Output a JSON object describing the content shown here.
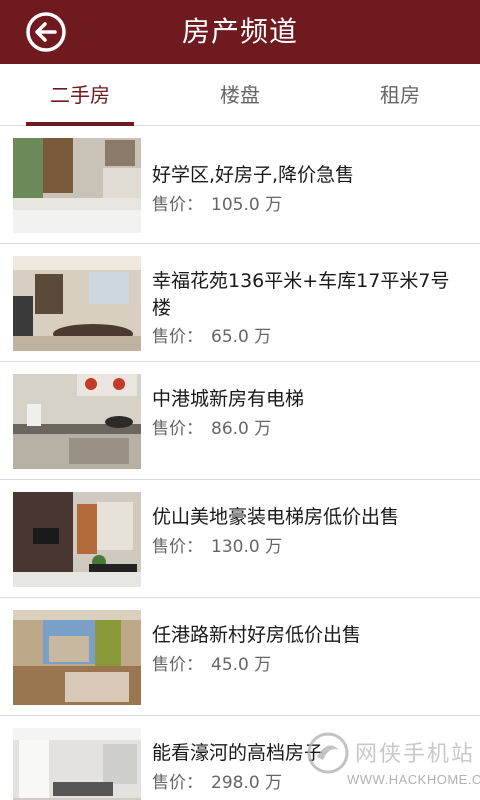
{
  "header": {
    "title": "房产频道",
    "back_icon": "back-arrow-icon",
    "background": "#6e1a1e"
  },
  "tabs": [
    {
      "label": "二手房",
      "active": true
    },
    {
      "label": "楼盘",
      "active": false
    },
    {
      "label": "租房",
      "active": false
    }
  ],
  "listings": [
    {
      "title": "好学区,好房子,降价急售",
      "price_label": "售价：",
      "price": "105.0 万",
      "image": "bedroom-photo"
    },
    {
      "title": "幸福花苑136平米+车库17平米7号楼",
      "price_label": "售价：",
      "price": "65.0 万",
      "image": "living-room-photo"
    },
    {
      "title": "中港城新房有电梯",
      "price_label": "售价：",
      "price": "86.0 万",
      "image": "kitchen-photo"
    },
    {
      "title": "优山美地豪装电梯房低价出售",
      "price_label": "售价：",
      "price": "130.0 万",
      "image": "tv-wall-living-room-photo"
    },
    {
      "title": "任港路新村好房低价出售",
      "price_label": "售价：",
      "price": "45.0 万",
      "image": "bedroom-window-photo"
    },
    {
      "title": "能看濠河的高档房子",
      "price_label": "售价：",
      "price": "298.0 万",
      "image": "bright-living-room-photo"
    }
  ],
  "watermark": {
    "line1": "网侠手机站",
    "line2": "WWW.HACKHOME.COM"
  }
}
